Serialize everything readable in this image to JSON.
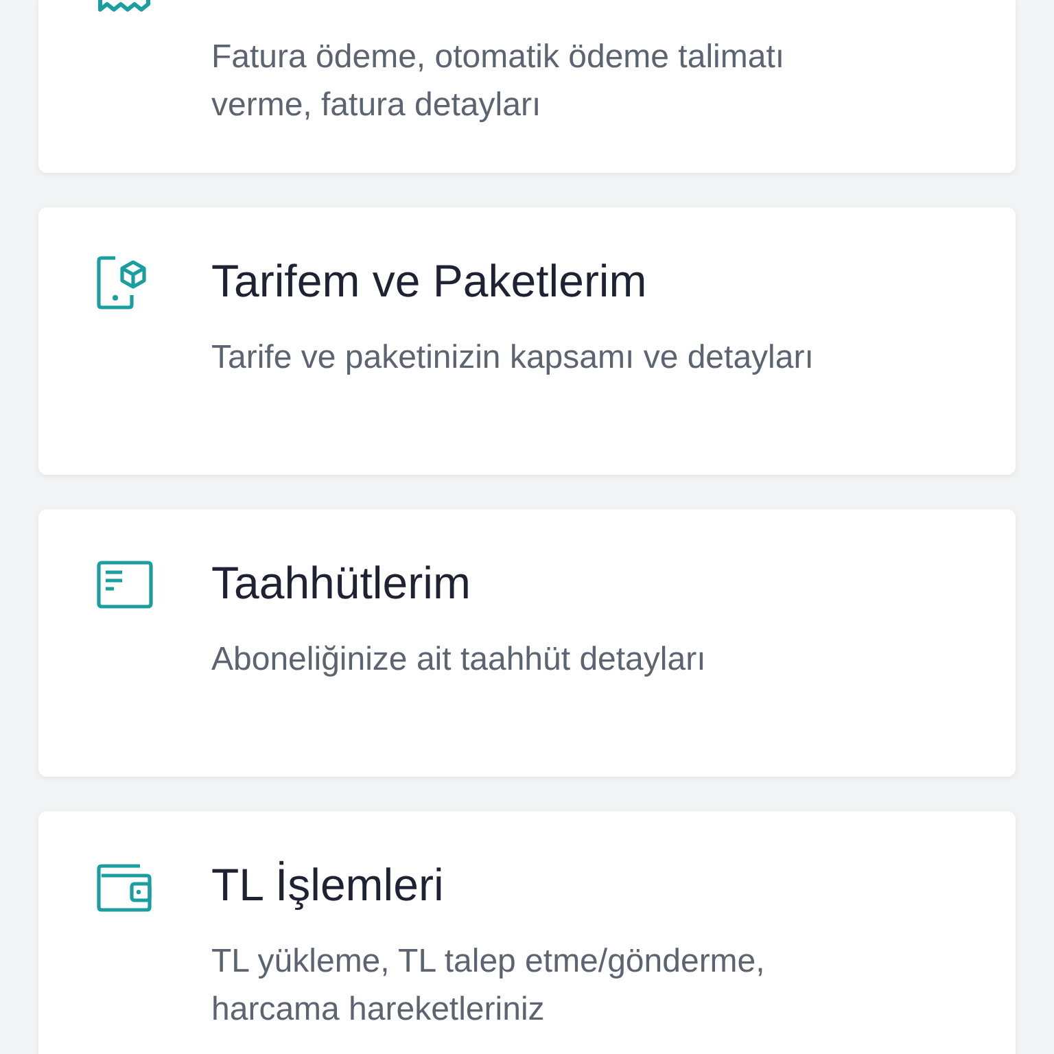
{
  "menu_items": [
    {
      "kind": "receipt",
      "description": "Fatura ödeme, otomatik ödeme talimatı verme, fatura detayları"
    },
    {
      "kind": "tariff",
      "title": "Tarifem ve Paketlerim",
      "description": "Tarife ve paketinizin kapsamı ve detayları"
    },
    {
      "kind": "commitment",
      "title": "Taahhütlerim",
      "description": "Aboneliğinize ait taahhüt detayları"
    },
    {
      "kind": "wallet",
      "title": "TL İşlemleri",
      "description": "TL yükleme, TL talep etme/gönderme, harcama hareketleriniz"
    }
  ]
}
